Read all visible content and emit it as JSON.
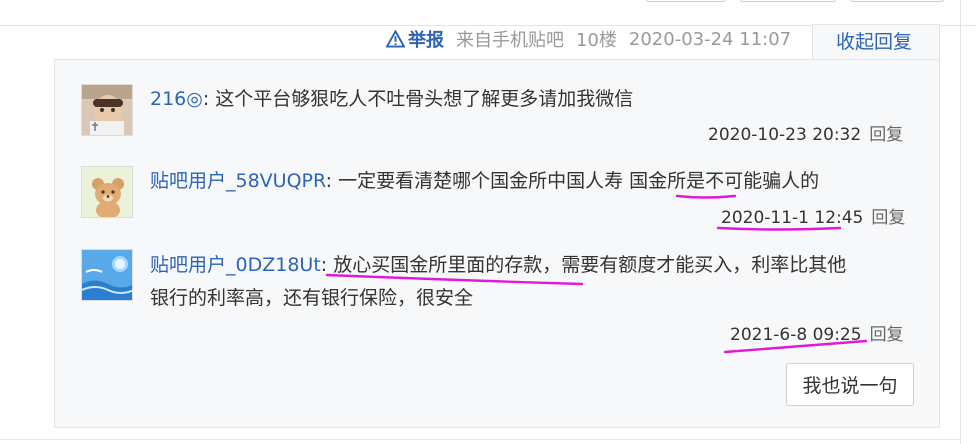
{
  "floor_meta": {
    "report_label": "举报",
    "source": "来自手机贴吧",
    "floor": "10楼",
    "time": "2020-03-24 11:07",
    "collapse_label": "收起回复"
  },
  "replies": [
    {
      "user": "216◎",
      "sep": ": ",
      "text": "这个平台够狠吃人不吐骨头想了解更多请加我微信",
      "text_line2": "",
      "time": "2020-10-23 20:32",
      "reply_label": "回复"
    },
    {
      "user": "贴吧用户_58VUQPR",
      "sep": ": ",
      "text": "一定要看清楚哪个国金所中国人寿 国金所是不可能骗人的",
      "text_line2": "",
      "time": "2020-11-1 12:45",
      "reply_label": "回复"
    },
    {
      "user": "贴吧用户_0DZ18Ut",
      "sep": ": ",
      "text": "放心买国金所里面的存款，需要有额度才能买入，利率比其他",
      "text_line2": "银行的利率高，还有银行保险，很安全",
      "time": "2021-6-8 09:25",
      "reply_label": "回复"
    }
  ],
  "say_button_label": "我也说一句",
  "colors": {
    "link_blue": "#2d64b3",
    "panel_bg": "#f7f8fa",
    "annotation_magenta": "#e01ad6"
  }
}
